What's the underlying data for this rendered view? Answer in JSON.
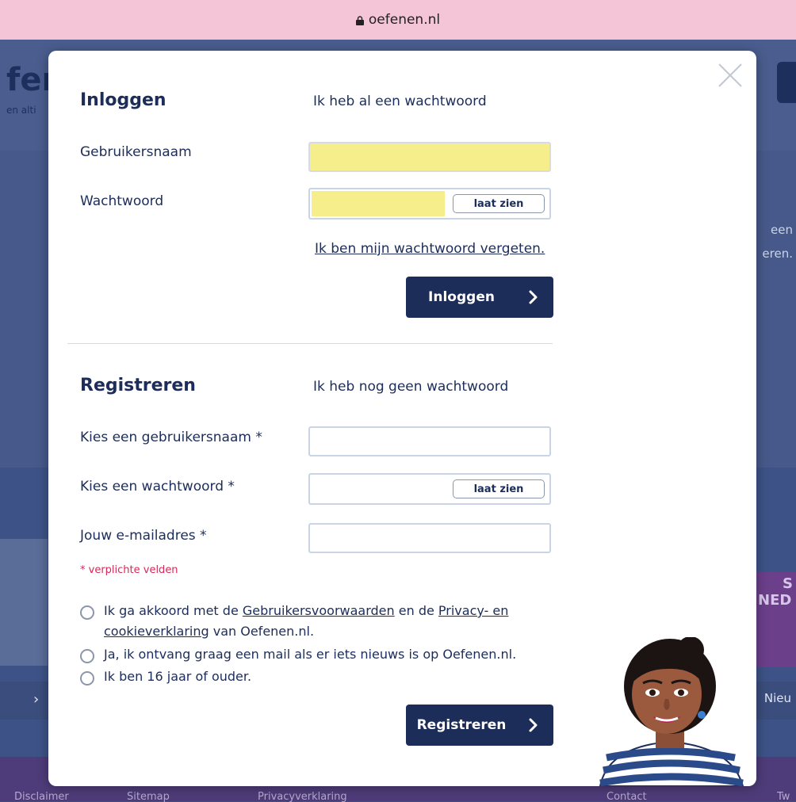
{
  "browser": {
    "url": "oefenen.nl"
  },
  "background": {
    "logo_partial": "fen",
    "tagline_partial": "en alti",
    "right_text": [
      "een",
      "eren."
    ],
    "promo_partial": [
      "S",
      "NED"
    ],
    "nav_right": "Nieu",
    "footer_links": [
      "Disclaimer",
      "Sitemap",
      "Privacyverklaring",
      "Contact",
      "Tw"
    ]
  },
  "login": {
    "heading": "Inloggen",
    "subheading": "Ik heb al een wachtwoord",
    "username_label": "Gebruikersnaam",
    "username_value": "",
    "password_label": "Wachtwoord",
    "password_value": "",
    "show_label": "laat zien",
    "forgot_link": "Ik ben mijn wachtwoord vergeten.",
    "submit_label": "Inloggen"
  },
  "register": {
    "heading": "Registreren",
    "subheading": "Ik heb nog geen wachtwoord",
    "username_label": "Kies een gebruikersnaam *",
    "password_label": "Kies een wachtwoord *",
    "email_label": "Jouw e-mailadres *",
    "show_label": "laat zien",
    "required_note": "* verplichte velden",
    "terms": {
      "prefix": "Ik ga akkoord met de ",
      "link1": "Gebruikersvoorwaarden",
      "middle": " en de ",
      "link2a": "Privacy- en",
      "link2b": "cookieverklaring",
      "suffix": " van Oefenen.nl."
    },
    "newsletter": "Ja, ik ontvang graag een mail als er iets nieuws is op Oefenen.nl.",
    "age": "Ik ben 16 jaar of ouder.",
    "submit_label": "Registreren"
  },
  "colors": {
    "navy": "#1c2d5a",
    "highlight": "#f5ee8a",
    "required": "#d6285a",
    "urlbar": "#f4c5d6"
  }
}
